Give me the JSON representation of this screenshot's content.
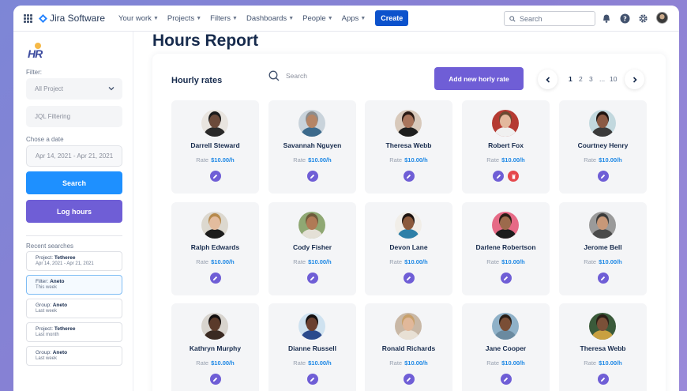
{
  "nav": {
    "app_name": "Jira Software",
    "items": [
      "Your work",
      "Projects",
      "Filters",
      "Dashboards",
      "People",
      "Apps"
    ],
    "create_label": "Create",
    "search_placeholder": "Search"
  },
  "sidebar": {
    "logo_text": "HR",
    "filter_label": "Filter:",
    "project_select": "All Project",
    "jql_placeholder": "JQL Filtering",
    "date_label": "Chose a date",
    "date_range": "Apr 14, 2021 - Apr 21, 2021",
    "search_button": "Search",
    "log_button": "Log hours",
    "recent_label": "Recent searches",
    "recent": [
      {
        "prefix": "Project:",
        "name": "Tetheree",
        "detail": "Apr 14, 2021 - Apr 21, 2021"
      },
      {
        "prefix": "Filter:",
        "name": "Aneto",
        "detail": "This week"
      },
      {
        "prefix": "Group:",
        "name": "Aneto",
        "detail": "Last week"
      },
      {
        "prefix": "Project:",
        "name": "Tetheree",
        "detail": "Last month"
      },
      {
        "prefix": "Group:",
        "name": "Aneto",
        "detail": "Last week"
      }
    ]
  },
  "main": {
    "page_title": "Hours Report",
    "panel_title": "Hourly rates",
    "search_placeholder": "Search",
    "add_button": "Add new horly rate",
    "pagination": {
      "pages": [
        "1",
        "2",
        "3",
        "...",
        "10"
      ],
      "current": "1"
    },
    "rate_label": "Rate",
    "people": [
      {
        "name": "Darrell Steward",
        "rate": "$10.00/h",
        "deletable": false,
        "skin": "#6b4a3a",
        "hair": "#1b1b1b",
        "shirt": "#2a2a2a",
        "bg": "#e8e4df"
      },
      {
        "name": "Savannah Nguyen",
        "rate": "$10.00/h",
        "deletable": false,
        "skin": "#b58566",
        "hair": "#8c8c8c",
        "shirt": "#3c6a8c",
        "bg": "#c9d3db"
      },
      {
        "name": "Theresa Webb",
        "rate": "$10.00/h",
        "deletable": false,
        "skin": "#a9755c",
        "hair": "#2a1a14",
        "shirt": "#1e1e1e",
        "bg": "#d8c9bb"
      },
      {
        "name": "Robert Fox",
        "rate": "$10.00/h",
        "deletable": true,
        "skin": "#e3b89d",
        "hair": "#6a4a32",
        "shirt": "#f0f0f0",
        "bg": "#b53a32"
      },
      {
        "name": "Courtney Henry",
        "rate": "$10.00/h",
        "deletable": false,
        "skin": "#8a5a44",
        "hair": "#1e1410",
        "shirt": "#3a3a3a",
        "bg": "#c2d8de"
      },
      {
        "name": "Ralph Edwards",
        "rate": "$10.00/h",
        "deletable": false,
        "skin": "#e3bc9e",
        "hair": "#b78a4c",
        "shirt": "#1c1c1c",
        "bg": "#dcd8cf"
      },
      {
        "name": "Cody Fisher",
        "rate": "$10.00/h",
        "deletable": false,
        "skin": "#b07a56",
        "hair": "#6e5a3a",
        "shirt": "#e4e0d6",
        "bg": "#8fa873"
      },
      {
        "name": "Devon Lane",
        "rate": "$10.00/h",
        "deletable": false,
        "skin": "#8c5a3c",
        "hair": "#1e1410",
        "shirt": "#2d7fa8",
        "bg": "#f1eee8"
      },
      {
        "name": "Darlene Robertson",
        "rate": "$10.00/h",
        "deletable": false,
        "skin": "#9c6a4c",
        "hair": "#2a1e16",
        "shirt": "#1c1c1c",
        "bg": "#e66a86"
      },
      {
        "name": "Jerome Bell",
        "rate": "$10.00/h",
        "deletable": false,
        "skin": "#c89878",
        "hair": "#3a3a3a",
        "shirt": "#4a4a4a",
        "bg": "#9a9a9a"
      },
      {
        "name": "Kathryn Murphy",
        "rate": "$10.00/h",
        "deletable": false,
        "skin": "#5a3a2a",
        "hair": "#141010",
        "shirt": "#3a2a22",
        "bg": "#d8d4ce"
      },
      {
        "name": "Dianne Russell",
        "rate": "$10.00/h",
        "deletable": false,
        "skin": "#6a4030",
        "hair": "#141010",
        "shirt": "#2a4a8c",
        "bg": "#cfe2f0"
      },
      {
        "name": "Ronald Richards",
        "rate": "$10.00/h",
        "deletable": false,
        "skin": "#e1b89a",
        "hair": "#c8a06a",
        "shirt": "#e8e0d4",
        "bg": "#c9b8a6"
      },
      {
        "name": "Jane Cooper",
        "rate": "$10.00/h",
        "deletable": false,
        "skin": "#7a4e36",
        "hair": "#2a1e16",
        "shirt": "#6a8aa0",
        "bg": "#8fb1c8"
      },
      {
        "name": "Theresa Webb",
        "rate": "$10.00/h",
        "deletable": false,
        "skin": "#7a5038",
        "hair": "#2a1e16",
        "shirt": "#c8a040",
        "bg": "#3a5a3a"
      }
    ]
  },
  "colors": {
    "primary": "#6f5ed6",
    "blue": "#1e90ff",
    "create": "#0c52cc",
    "delete": "#e5484d",
    "rate": "#1e88e5"
  }
}
